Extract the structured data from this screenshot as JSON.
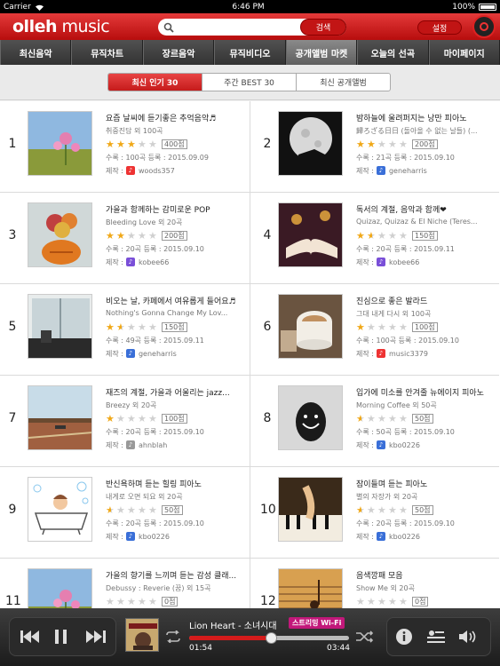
{
  "status_bar": {
    "carrier": "Carrier",
    "time": "6:46 PM",
    "battery": "100%"
  },
  "header": {
    "logo_bold": "olleh",
    "logo_thin": " music",
    "search_placeholder": "",
    "search_button": "검색",
    "settings_button": "설정"
  },
  "nav": {
    "items": [
      "최신음악",
      "뮤직차트",
      "장르음악",
      "뮤직비디오",
      "공개앨범 마켓",
      "오늘의 선곡",
      "마이페이지"
    ],
    "active_index": 4
  },
  "subtabs": {
    "items": [
      "최신 인기 30",
      "주간 BEST 30",
      "최신 공개앨범"
    ],
    "active_index": 0
  },
  "albums": [
    {
      "rank": "1",
      "title": "요즘 날씨에 듣기좋은 추억음악♬",
      "subtitle": "취중진담 외 100곡",
      "rating": 3,
      "score": "400점",
      "meta": "수록 : 100곡    등록 : 2015.09.09",
      "author_label": "제작 :",
      "author": "woods357",
      "author_icon_color": "#e33",
      "thumb": "flower-field"
    },
    {
      "rank": "2",
      "title": "밤하늘에 울려퍼지는 낭만 피아노",
      "subtitle": "歸ろざる日日 (돌아올 수 없는 날들) (...",
      "rating": 2,
      "score": "200점",
      "meta": "수록 : 21곡    등록 : 2015.09.10",
      "author_label": "제작 :",
      "author": "geneharris",
      "author_icon_color": "#3a6fd8",
      "thumb": "moon-piano"
    },
    {
      "rank": "3",
      "title": "가을과 함께하는 감미로운 POP",
      "subtitle": "Bleeding Love 외 20곡",
      "rating": 2,
      "score": "200점",
      "meta": "수록 : 20곡    등록 : 2015.09.10",
      "author_label": "제작 :",
      "author": "kobee66",
      "author_icon_color": "#7a4fd8",
      "thumb": "pumpkin-flowers"
    },
    {
      "rank": "4",
      "title": "독서의 계절, 음악과 함께❤",
      "subtitle": "Quizaz, Quizaz & El Niche (Teres...",
      "rating": 1.5,
      "score": "150점",
      "meta": "수록 : 20곡    등록 : 2015.09.11",
      "author_label": "제작 :",
      "author": "kobee66",
      "author_icon_color": "#7a4fd8",
      "thumb": "book-candles"
    },
    {
      "rank": "5",
      "title": "비오는 날, 카페에서 여유롭게 들어요♬",
      "subtitle": "Nothing's Gonna Change My Lov...",
      "rating": 1.5,
      "score": "150점",
      "meta": "수록 : 49곡    등록 : 2015.09.11",
      "author_label": "제작 :",
      "author": "geneharris",
      "author_icon_color": "#3a6fd8",
      "thumb": "rainy-window"
    },
    {
      "rank": "6",
      "title": "진심으로 좋은 발라드",
      "subtitle": "그대 내게 다시 외 100곡",
      "rating": 1,
      "score": "100점",
      "meta": "수록 : 100곡    등록 : 2015.09.10",
      "author_label": "제작 :",
      "author": "music3379",
      "author_icon_color": "#e33",
      "thumb": "coffee-cup"
    },
    {
      "rank": "7",
      "title": "재즈의 계절, 가을과 어울리는 jazz...",
      "subtitle": "Breezy 외 20곡",
      "rating": 1,
      "score": "100점",
      "meta": "수록 : 20곡    등록 : 2015.09.10",
      "author_label": "제작 :",
      "author": "ahnblah",
      "author_icon_color": "#999",
      "thumb": "field-road"
    },
    {
      "rank": "8",
      "title": "입가에 미소를 안겨줄 뉴에이지 피아노",
      "subtitle": "Morning Coffee 외 50곡",
      "rating": 0.5,
      "score": "50점",
      "meta": "수록 : 50곡    등록 : 2015.09.10",
      "author_label": "제작 :",
      "author": "kbo0226",
      "author_icon_color": "#3a6fd8",
      "thumb": "smiley-egg"
    },
    {
      "rank": "9",
      "title": "반신욕하며 듣는 힐링 피아노",
      "subtitle": "내게로 오면 되요 외 20곡",
      "rating": 0.5,
      "score": "50점",
      "meta": "수록 : 20곡    등록 : 2015.09.10",
      "author_label": "제작 :",
      "author": "kbo0226",
      "author_icon_color": "#3a6fd8",
      "thumb": "bathtub"
    },
    {
      "rank": "10",
      "title": "잠이들며 듣는 피아노",
      "subtitle": "별의 자장가 외 20곡",
      "rating": 0.5,
      "score": "50점",
      "meta": "수록 : 20곡    등록 : 2015.09.10",
      "author_label": "제작 :",
      "author": "kbo0226",
      "author_icon_color": "#3a6fd8",
      "thumb": "piano-hands"
    },
    {
      "rank": "11",
      "title": "가을의 향기를 느끼며 듣는 감성 클래...",
      "subtitle": "Debussy : Reverie (꿈) 외 15곡",
      "rating": 0,
      "score": "0점",
      "meta": "",
      "author_label": "",
      "author": "",
      "author_icon_color": "#3a6fd8",
      "thumb": "flower-field"
    },
    {
      "rank": "12",
      "title": "음색깡패 모음",
      "subtitle": "Show Me 외 20곡",
      "rating": 0,
      "score": "0점",
      "meta": "",
      "author_label": "",
      "author": "",
      "author_icon_color": "#3a6fd8",
      "thumb": "music-notes"
    }
  ],
  "player": {
    "track": "Lion Heart - 소녀시대",
    "badge": "스트리밍 Wi-Fi",
    "current_time": "01:54",
    "total_time": "03:44",
    "progress_fraction": 0.51
  }
}
